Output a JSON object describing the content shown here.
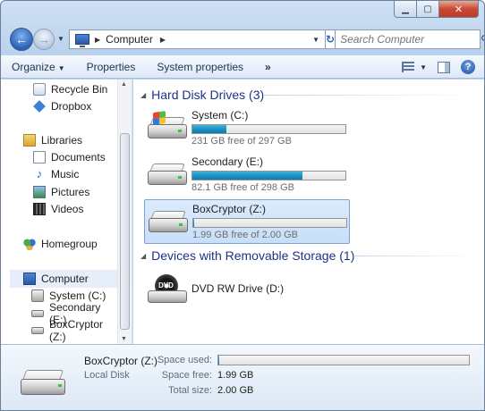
{
  "window": {
    "minimize_glyph": "▁",
    "maximize_glyph": "▢",
    "close_glyph": "✕"
  },
  "address": {
    "location": "Computer",
    "search_placeholder": "Search Computer"
  },
  "toolbar": {
    "organize_label": "Organize",
    "properties_label": "Properties",
    "system_properties_label": "System properties",
    "more_label": "»",
    "help_label": "?"
  },
  "sidebar": {
    "items": [
      {
        "label": "Recycle Bin",
        "icon": "recycle-bin-icon"
      },
      {
        "label": "Dropbox",
        "icon": "dropbox-icon"
      },
      {
        "label": "Libraries",
        "icon": "libraries-icon"
      },
      {
        "label": "Documents",
        "icon": "documents-icon"
      },
      {
        "label": "Music",
        "icon": "music-icon"
      },
      {
        "label": "Pictures",
        "icon": "pictures-icon"
      },
      {
        "label": "Videos",
        "icon": "videos-icon"
      },
      {
        "label": "Homegroup",
        "icon": "homegroup-icon"
      },
      {
        "label": "Computer",
        "icon": "computer-icon"
      },
      {
        "label": "System (C:)",
        "icon": "drive-icon"
      },
      {
        "label": "Secondary (E:)",
        "icon": "drive-icon"
      },
      {
        "label": "BoxCryptor (Z:)",
        "icon": "drive-icon"
      }
    ],
    "selected": "Computer"
  },
  "main": {
    "hard_disks_header": "Hard Disk Drives (3)",
    "removable_header": "Devices with Removable Storage (1)",
    "drives": [
      {
        "name": "System (C:)",
        "free_text": "231 GB free of 297 GB",
        "used_fraction": 0.22,
        "system": true
      },
      {
        "name": "Secondary (E:)",
        "free_text": "82.1 GB free of 298 GB",
        "used_fraction": 0.72,
        "system": false
      },
      {
        "name": "BoxCryptor (Z:)",
        "free_text": "1.99 GB free of 2.00 GB",
        "used_fraction": 0.005,
        "system": false
      }
    ],
    "dvd": {
      "name": "DVD RW Drive (D:)",
      "label": "DVD"
    }
  },
  "details": {
    "name": "BoxCryptor (Z:)",
    "type": "Local Disk",
    "space_used_label": "Space used:",
    "space_used_fraction": 0.005,
    "space_free_label": "Space free:",
    "space_free_value": "1.99 GB",
    "total_size_label": "Total size:",
    "total_size_value": "2.00 GB"
  },
  "colors": {
    "accent": "#1e3287",
    "bar_fill": "#1a8ec3",
    "selection": "#c7defa"
  }
}
